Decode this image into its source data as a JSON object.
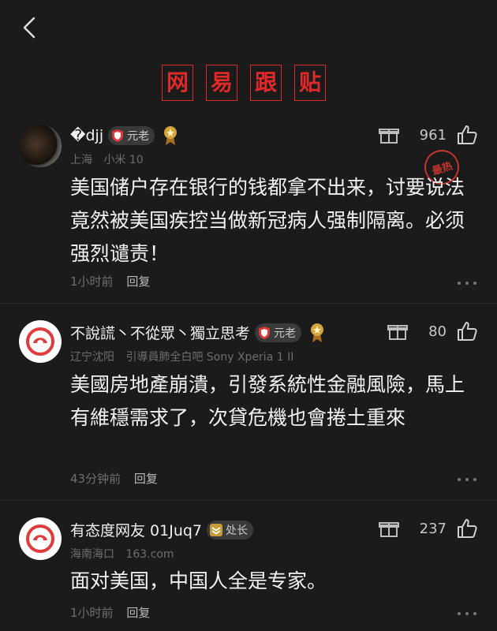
{
  "header": {
    "title_chars": [
      "网",
      "易",
      "跟",
      "贴"
    ]
  },
  "comments": [
    {
      "username": "�djj",
      "badge": "元老",
      "location": "上海",
      "device": "小米 10",
      "likes": "961",
      "hot_label": "最热",
      "content": "美国储户存在银行的钱都拿不出来，讨要说法竟然被美国疾控当做新冠病人强制隔离。必须强烈谴责！",
      "time": "1小时前",
      "reply": "回复"
    },
    {
      "username": "不說謊丶不從眾丶獨立思考",
      "badge": "元老",
      "location": "辽宁沈阳",
      "device": "引導員肺全白吧 Sony Xperia 1 II",
      "likes": "80",
      "content": "美國房地產崩潰，引發系統性金融風險，馬上有維穩需求了，次貸危機也會捲土重來",
      "time": "43分钟前",
      "reply": "回复"
    },
    {
      "username": "有态度网友 01Juq7",
      "badge": "处长",
      "location": "海南海口",
      "device": "163.com",
      "likes": "237",
      "content": "面对美国，中国人全是专家。",
      "time": "1小时前",
      "reply": "回复"
    }
  ],
  "colors": {
    "accent_red": "#e02a2a",
    "badge_gold": "#c79a3a"
  },
  "icons": [
    "back-icon",
    "gift-icon",
    "thumb-up-icon",
    "more-icon",
    "shield-icon",
    "medal-icon"
  ]
}
